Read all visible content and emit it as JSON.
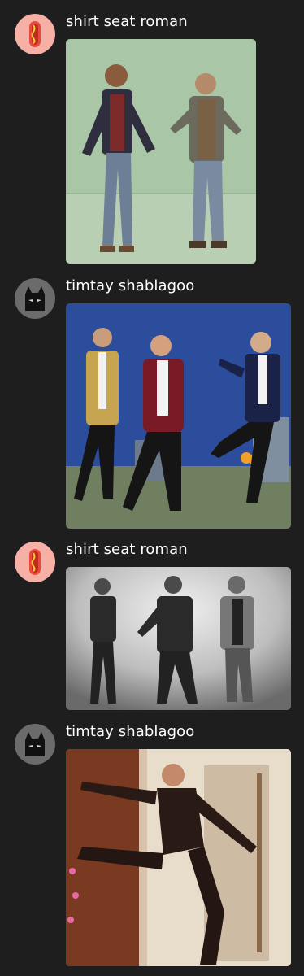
{
  "messages": [
    {
      "username": "shirt seat roman",
      "avatar_icon": "hotdog-icon",
      "image": "gif-image"
    },
    {
      "username": "timtay shablagoo",
      "avatar_icon": "batman-icon",
      "image": "gif-image"
    },
    {
      "username": "shirt seat roman",
      "avatar_icon": "hotdog-icon",
      "image": "gif-image"
    },
    {
      "username": "timtay shablagoo",
      "avatar_icon": "batman-icon",
      "image": "gif-image"
    }
  ],
  "colors": {
    "background": "#1e1e1e",
    "hotdog_avatar_bg": "#f6b0a6",
    "batman_avatar_bg": "#6b6b6b"
  }
}
